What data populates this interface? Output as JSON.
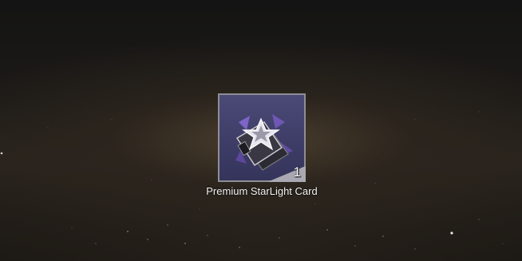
{
  "reward": {
    "item_name": "Premium StarLight Card",
    "count": "1",
    "icon": "starlight-card-icon"
  }
}
